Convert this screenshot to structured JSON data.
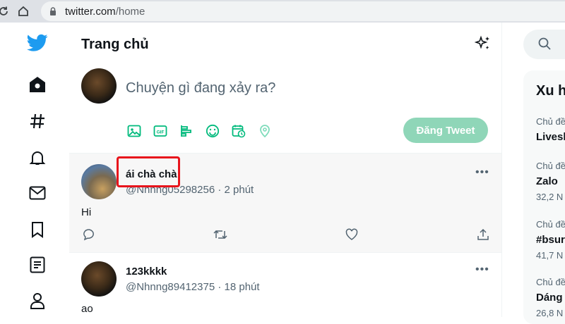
{
  "browser": {
    "url_host": "twitter.com",
    "url_path": "/home"
  },
  "header": {
    "title": "Trang chủ"
  },
  "compose": {
    "placeholder": "Chuyện gì đang xảy ra?",
    "tweet_button": "Đăng Tweet",
    "tools": [
      "image-icon",
      "gif-icon",
      "poll-icon",
      "emoji-icon",
      "schedule-icon",
      "location-icon"
    ]
  },
  "tweets": [
    {
      "name": "ái chà chà",
      "handle": "@Nhnng05298256",
      "time": "2 phút",
      "text": "Hi"
    },
    {
      "name": "123kkkk",
      "handle": "@Nhnng89412375",
      "time": "18 phút",
      "text": "ao"
    }
  ],
  "sidebar": {
    "search_icon": "search-icon"
  },
  "trends": {
    "title": "Xu h",
    "items": [
      {
        "category": "Chủ đề",
        "name": "Livesh",
        "count": ""
      },
      {
        "category": "Chủ đề",
        "name": "Zalo",
        "count": "32,2 N"
      },
      {
        "category": "Chủ đề",
        "name": "#bsur",
        "count": "41,7 N"
      },
      {
        "category": "Chủ đề",
        "name": "Dáng",
        "count": "26,8 N"
      }
    ]
  },
  "colors": {
    "twitter_blue": "#1d9bf0",
    "accent_green": "#00ba7c",
    "highlight_red": "#e8141c"
  },
  "separator": "·"
}
